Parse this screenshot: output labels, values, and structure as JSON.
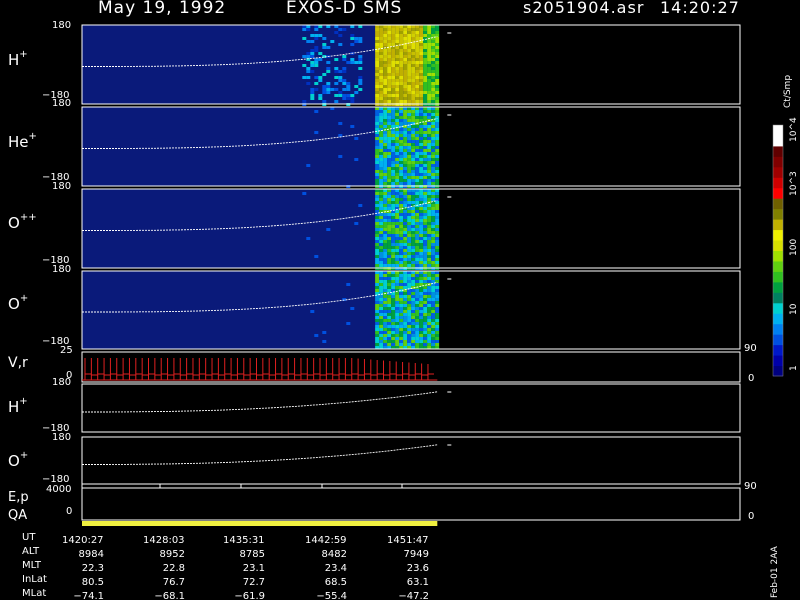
{
  "header": {
    "date": "May 19, 1992",
    "instrument": "EXOS-D SMS",
    "file": "s2051904.asr",
    "time": "14:20:27"
  },
  "species_panels": [
    {
      "label": "H",
      "sup": "+"
    },
    {
      "label": "He",
      "sup": "+"
    },
    {
      "label": "O",
      "sup": "++"
    },
    {
      "label": "O",
      "sup": "+"
    }
  ],
  "angle_ticks": {
    "top": "180",
    "bottom": "−180"
  },
  "vr_panel": {
    "label": "V,r",
    "left_top": "25",
    "left_bottom": "0",
    "right_top": "90",
    "right_bottom": "0"
  },
  "lower_species_panels": [
    {
      "label": "H",
      "sup": "+"
    },
    {
      "label": "O",
      "sup": "+"
    }
  ],
  "ep_panel": {
    "label_top": "E,p",
    "label_bottom": "QA",
    "left_top": "4000",
    "left_bottom": "0",
    "right_top": "90",
    "right_bottom": "0"
  },
  "colorbar": {
    "unit": "Ct/Smp",
    "tick_labels": [
      "1",
      "10",
      "100",
      "10^3",
      "10^4"
    ],
    "colors": [
      "#000080",
      "#0000a8",
      "#0018c8",
      "#0050e0",
      "#0080f0",
      "#00b0f0",
      "#00d0d0",
      "#008060",
      "#00a040",
      "#30c020",
      "#60d010",
      "#a0e000",
      "#d8e000",
      "#f0f000",
      "#c0b000",
      "#808000",
      "#706000",
      "#ff0000",
      "#d00000",
      "#a00000",
      "#800000",
      "#600000",
      "#ffffff",
      "#ffffff"
    ]
  },
  "orbit_table": {
    "row_labels": [
      "UT",
      "ALT",
      "MLT",
      "InLat",
      "MLat"
    ],
    "columns": [
      [
        "1420:27",
        "8984",
        "22.3",
        "80.5",
        "−74.1"
      ],
      [
        "1428:03",
        "8952",
        "22.8",
        "76.7",
        "−68.1"
      ],
      [
        "1435:31",
        "8785",
        "23.1",
        "72.7",
        "−61.9"
      ],
      [
        "1442:59",
        "8482",
        "23.4",
        "68.5",
        "−55.4"
      ],
      [
        "1451:47",
        "7949",
        "23.6",
        "63.1",
        "−47.2"
      ]
    ]
  },
  "footer_note": "Feb-01 2AA",
  "chart_data": {
    "type": "heatmap",
    "title": "May 19, 1992  EXOS-D SMS  s2051904.asr  14:20:27",
    "xlabel": "UT",
    "x_ticks": [
      "1420:27",
      "1428:03",
      "1435:31",
      "1442:59",
      "1451:47"
    ],
    "x_range": [
      "1420:27",
      "1456:00"
    ],
    "data_end_fraction": 0.54,
    "panels": [
      {
        "name": "H+",
        "ylim": [
          -180,
          180
        ],
        "dominant_level": "100"
      },
      {
        "name": "He+",
        "ylim": [
          -180,
          180
        ],
        "dominant_level": "10"
      },
      {
        "name": "O++",
        "ylim": [
          -180,
          180
        ],
        "dominant_level": "10"
      },
      {
        "name": "O+",
        "ylim": [
          -180,
          180
        ],
        "dominant_level": "10"
      }
    ],
    "colorbar_scale": "log",
    "colorbar_range": [
      1,
      10000
    ]
  }
}
